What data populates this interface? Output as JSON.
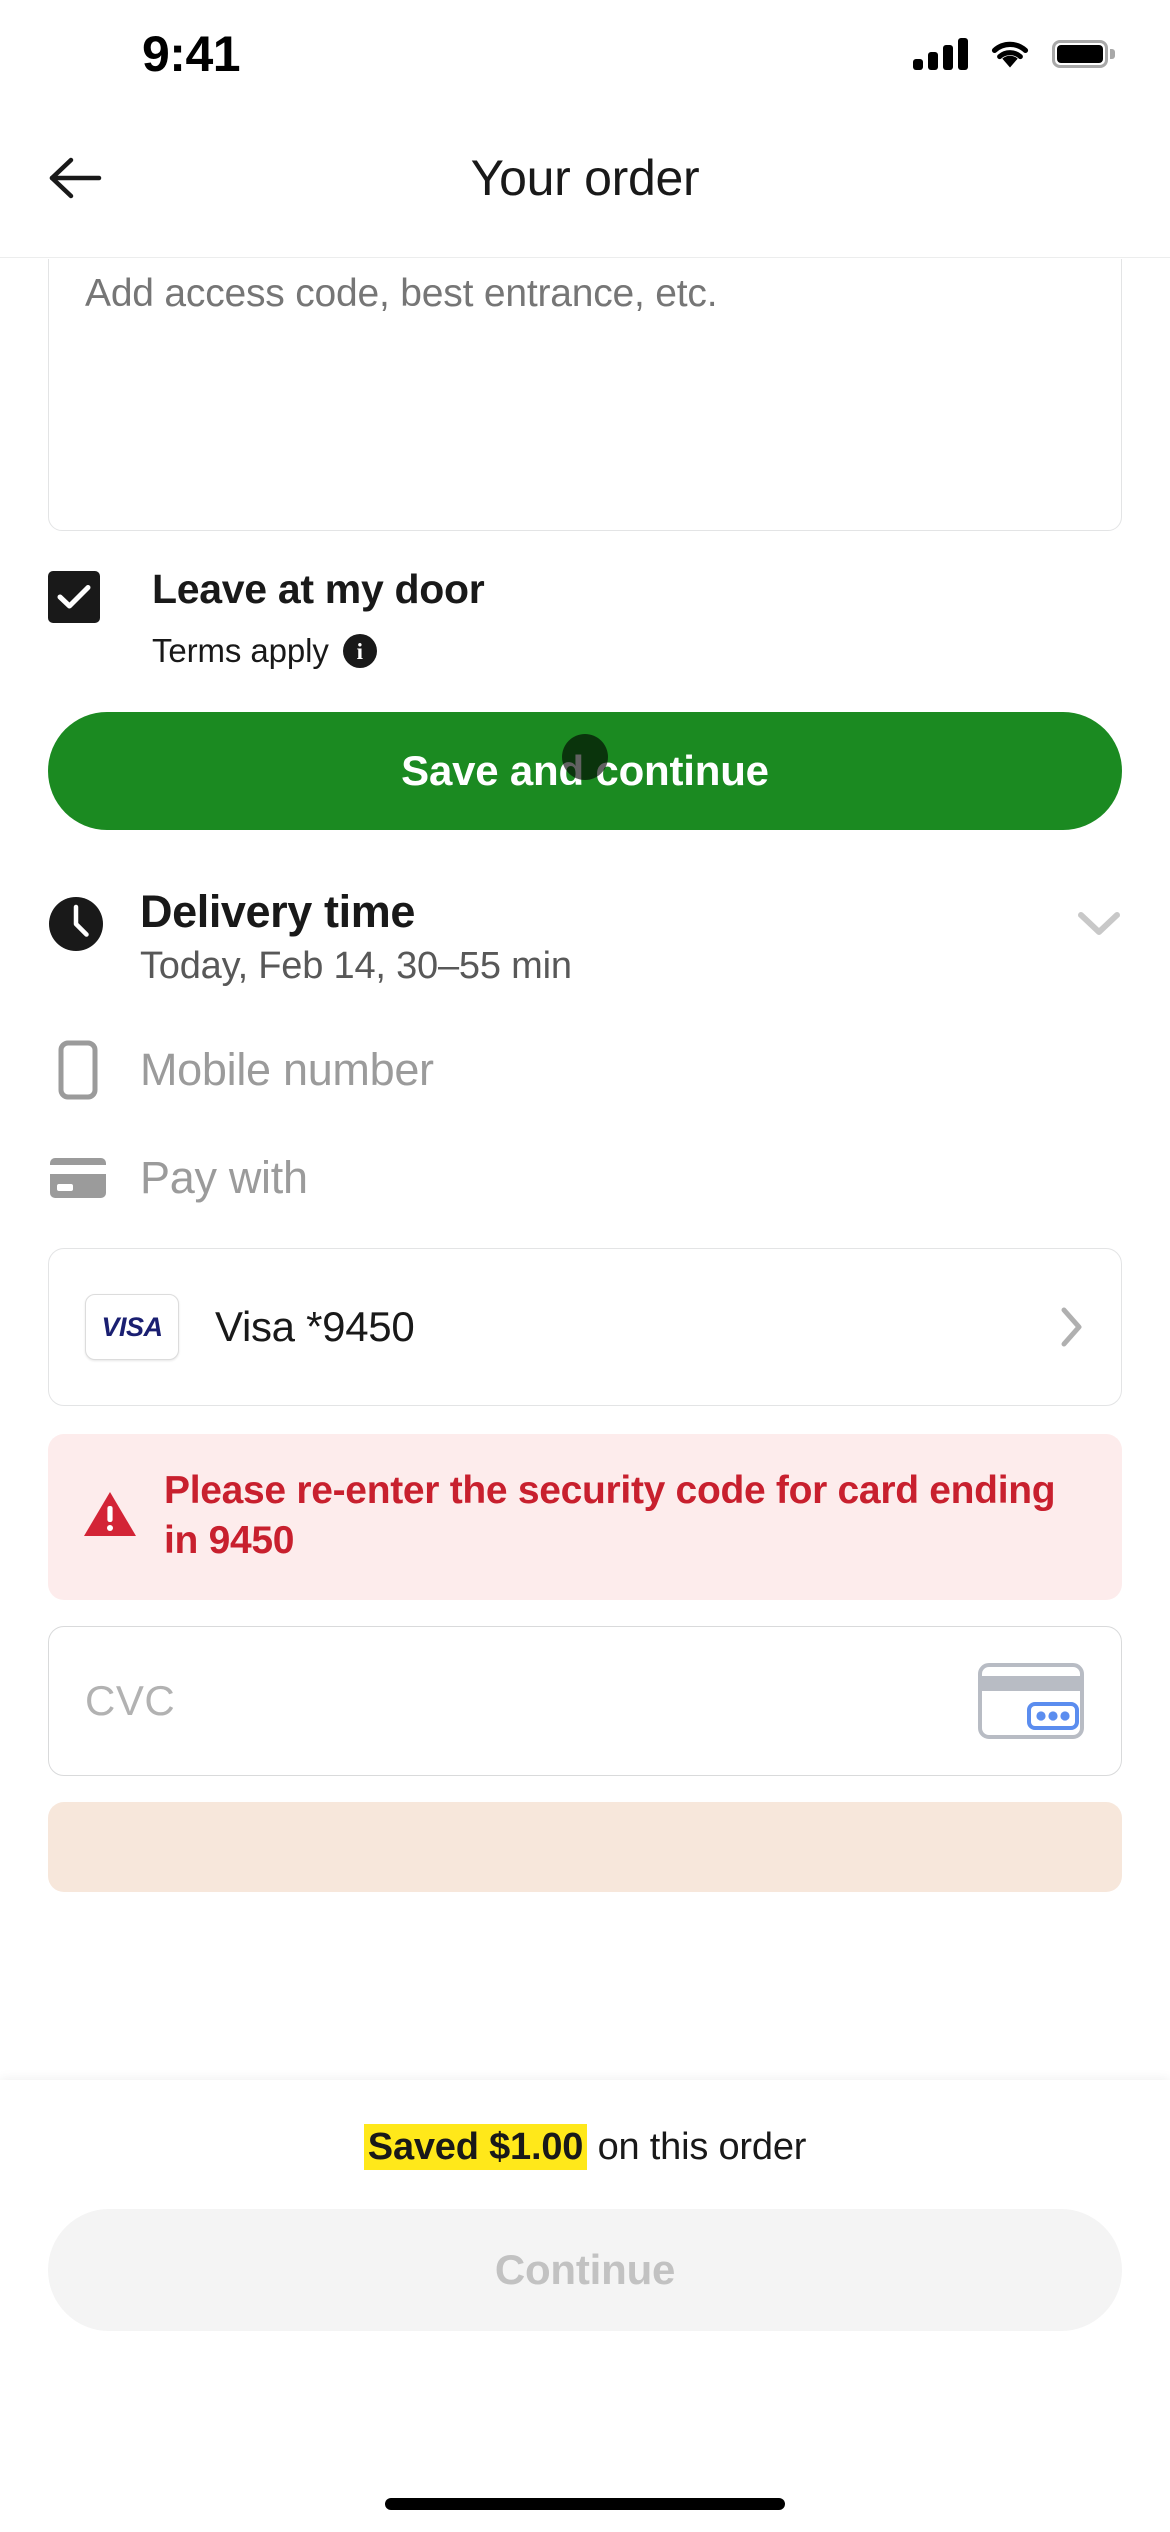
{
  "status_bar": {
    "time": "9:41",
    "cellular_icon": "cellular-signal-icon",
    "wifi_icon": "wifi-icon",
    "battery_icon": "battery-full-icon"
  },
  "header": {
    "back_icon": "back-arrow-icon",
    "title": "Your order"
  },
  "delivery_instructions": {
    "placeholder": "Add access code, best entrance, etc.",
    "value": ""
  },
  "leave_at_door": {
    "checked": true,
    "check_icon": "checkmark-icon",
    "label": "Leave at my door",
    "terms_label": "Terms apply",
    "info_icon": "info-icon",
    "info_glyph": "i"
  },
  "save_button": {
    "label": "Save and continue",
    "color": "#1b8a21",
    "touch_indicator": "touch-dot"
  },
  "delivery_time": {
    "icon": "clock-icon",
    "title": "Delivery time",
    "subtitle": "Today, Feb 14, 30–55 min",
    "chevron_icon": "chevron-down-icon"
  },
  "mobile_number": {
    "icon": "mobile-phone-icon",
    "label": "Mobile number"
  },
  "pay_with": {
    "icon": "credit-card-icon",
    "label": "Pay with"
  },
  "selected_card": {
    "brand_logo": "visa-logo",
    "brand_text": "VISA",
    "label": "Visa *9450",
    "chevron_icon": "chevron-right-icon",
    "brand_color": "#1a1f71"
  },
  "error_banner": {
    "icon": "warning-triangle-icon",
    "message": "Please re-enter the security code for card ending in 9450",
    "text_color": "#c8202e",
    "background_color": "#fdecec"
  },
  "cvc_field": {
    "placeholder": "CVC",
    "value": "",
    "icon": "card-back-cvc-icon"
  },
  "bottom_bar": {
    "saved_highlight": "Saved $1.00",
    "saved_suffix": " on this order",
    "highlight_color": "#ffe81a",
    "continue_label": "Continue",
    "continue_disabled": true
  }
}
